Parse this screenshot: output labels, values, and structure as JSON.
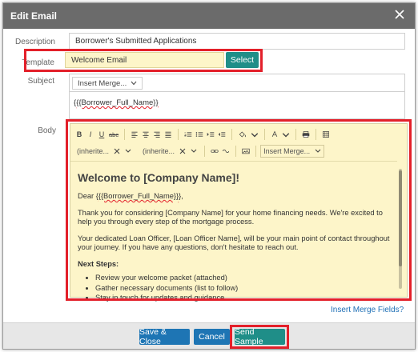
{
  "dialog": {
    "title": "Edit Email",
    "close_icon": "close-icon"
  },
  "description": {
    "label": "Description",
    "value": "Borrower's Submitted Applications"
  },
  "template": {
    "label": "Template",
    "value": "Welcome Email",
    "select_label": "Select"
  },
  "subject": {
    "label": "Subject",
    "insert_merge": "Insert Merge...",
    "value": "{{Borrower_Full_Name}}"
  },
  "body": {
    "label": "Body",
    "toolbar": {
      "bold": "B",
      "italic": "I",
      "underline": "U",
      "strikethrough": "abc",
      "font_family": "(inherite...",
      "font_size": "(inherite...",
      "insert_merge": "Insert Merge..."
    },
    "content": {
      "heading": "Welcome to [Company Name]!",
      "greeting_prefix": "Dear ",
      "greeting_field": "{{Borrower_Full_Name}}",
      "greeting_suffix": "},",
      "para1": "Thank you for considering [Company Name] for your home financing needs. We're excited to help you through every step of the mortgage process.",
      "para2": "Your dedicated Loan Officer, [Loan Officer Name], will be your main point of contact throughout your journey. If you have any questions, don't hesitate to reach out.",
      "next_steps": "Next Steps:",
      "steps": [
        "Review your welcome packet (attached)",
        "Gather necessary documents (list to follow)",
        "Stay in touch for updates and guidance"
      ]
    }
  },
  "insert_merge_fields_link": "Insert Merge Fields?",
  "footer": {
    "save_close": "Save & Close",
    "cancel": "Cancel",
    "send_sample": "Send Sample"
  },
  "colors": {
    "highlight": "#e3202a",
    "teal": "#1f8e88",
    "blue": "#1e75b4",
    "editor_bg": "#fdf5c9"
  }
}
